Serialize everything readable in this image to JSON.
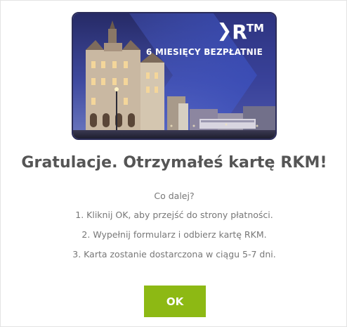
{
  "card": {
    "brand": "R",
    "brand_sup": "TM",
    "chevron_icon": "chevron-right-icon",
    "promo": "6 MIESIĘCY BEZPŁATNIE",
    "colors": {
      "sky_top": "#2e3474",
      "accent": "#3a4db8"
    }
  },
  "heading": "Gratulacje. Otrzymałeś kartę RKM!",
  "body": {
    "intro": "Co dalej?",
    "steps": [
      "1. Kliknij OK, aby przejść do strony płatności.",
      "2. Wypełnij formularz i odbierz kartę RKM.",
      "3. Karta zostanie dostarczona w ciągu 5-7 dni."
    ]
  },
  "ok_button": {
    "label": "OK",
    "color": "#8db914"
  }
}
